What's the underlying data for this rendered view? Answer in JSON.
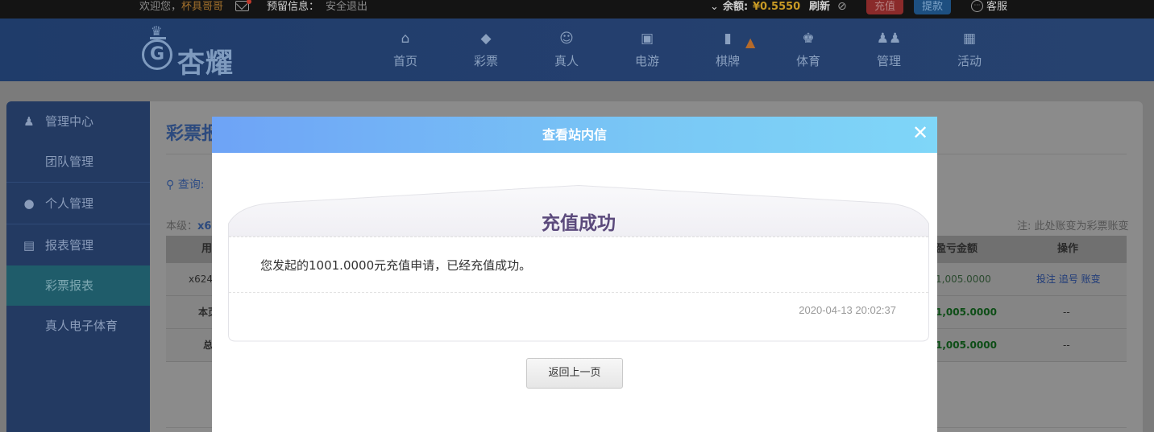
{
  "topbar": {
    "welcome": "欢迎您，",
    "username": "杯具哥哥",
    "reserved_label": "预留信息：",
    "logout": "安全退出",
    "balance_label": "余额:",
    "balance_value": "¥0.5550",
    "refresh": "刷新",
    "recharge": "充值",
    "withdraw": "提款",
    "customer_service": "客服"
  },
  "brand": {
    "name": "杏耀"
  },
  "nav": [
    {
      "label": "首页",
      "icon": "home-icon"
    },
    {
      "label": "彩票",
      "icon": "ticket-icon"
    },
    {
      "label": "真人",
      "icon": "person-icon"
    },
    {
      "label": "电游",
      "icon": "game-icon"
    },
    {
      "label": "棋牌",
      "icon": "cards-icon"
    },
    {
      "label": "体育",
      "icon": "trophy-icon"
    },
    {
      "label": "管理",
      "icon": "users-icon"
    },
    {
      "label": "活动",
      "icon": "gift-icon"
    }
  ],
  "sidebar": [
    {
      "label": "管理中心",
      "icon": "users-icon"
    },
    {
      "label": "团队管理"
    },
    {
      "label": "个人管理",
      "icon": "user-icon"
    },
    {
      "label": "报表管理",
      "icon": "report-icon"
    },
    {
      "label": "彩票报表"
    },
    {
      "label": "真人电子体育"
    }
  ],
  "content": {
    "title": "彩票报",
    "query": "查询:",
    "level_label": "本级：",
    "level_value": "x6",
    "note": "注: 此处账变为彩票账变",
    "headers": {
      "user": "用",
      "profit": "盈亏金额",
      "op": "操作"
    },
    "rows": [
      {
        "user": "x624",
        "profit": "1,005.0000",
        "ops": "投注 追号 账变"
      },
      {
        "user": "本页",
        "profit": "1,005.0000",
        "ops": "--"
      },
      {
        "user": "总",
        "profit": "1,005.0000",
        "ops": "--"
      }
    ]
  },
  "modal": {
    "title": "查看站内信",
    "card_title": "充值成功",
    "message": "您发起的1001.0000元充值申请，已经充值成功。",
    "time": "2020-04-13 20:02:37",
    "back": "返回上一页"
  }
}
